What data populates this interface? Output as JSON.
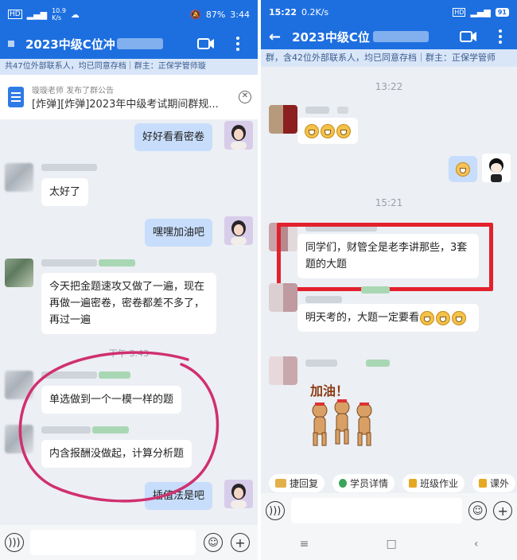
{
  "left": {
    "status": {
      "net_speed": "10.9\nK/s",
      "battery": "87%",
      "time": "3:44"
    },
    "header": {
      "title": "2023中级C位冲"
    },
    "info_bar": "共47位外部联系人，均已同意存档｜群主：正保学管师璇",
    "notice": {
      "author": "璇璇老师 发布了群公告",
      "text": "[炸弹][炸弹]2023年中级考试期间群规..."
    },
    "messages": [
      {
        "side": "me",
        "text": "好好看看密卷"
      },
      {
        "side": "other",
        "text": "太好了"
      },
      {
        "side": "me",
        "text": "嘿嘿加油吧"
      },
      {
        "side": "other",
        "text": "今天把金题速攻又做了一遍，现在再做一遍密卷，密卷都差不多了，再过一遍"
      },
      {
        "side": "other",
        "text": "单选做到一个一模一样的题"
      },
      {
        "side": "other",
        "text": "内含报酬没做起，计算分析题"
      },
      {
        "side": "me",
        "text": "插值法是吧"
      }
    ],
    "time_divider": "下午 3:43"
  },
  "right": {
    "status": {
      "time": "15:22",
      "net_speed": "0.2K/s",
      "battery": "91"
    },
    "header": {
      "title": "2023中级C位"
    },
    "info_bar": "群，含42位外部联系人，均已同意存档｜群主：正保学管师",
    "time1": "13:22",
    "time2": "15:21",
    "messages": [
      {
        "side": "other",
        "text": "同学们，财管全是老李讲那些，3套题的大题"
      },
      {
        "side": "other",
        "text": "明天考的，大题一定要看"
      }
    ],
    "sticker_text": "加油！",
    "quick_actions": [
      "捷回复",
      "学员详情",
      "班级作业",
      "课外"
    ],
    "nav": [
      "≡",
      "□",
      "‹"
    ]
  },
  "colors": {
    "brand_blue": "#1d6fe0",
    "highlight_red": "#e2212d",
    "circle_pink": "#d0306f"
  }
}
